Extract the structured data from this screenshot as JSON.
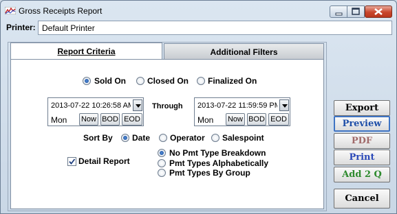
{
  "window": {
    "title": "Gross Receipts Report"
  },
  "printer": {
    "label": "Printer:",
    "value": "Default Printer"
  },
  "tabs": {
    "report_criteria": "Report Criteria",
    "additional_filters": "Additional Filters"
  },
  "date_mode": {
    "options": [
      "Sold On",
      "Closed On",
      "Finalized On"
    ],
    "selected": "Sold On"
  },
  "range": {
    "start": {
      "value": "2013-07-22 10:26:58 AM",
      "day": "Mon"
    },
    "through_label": "Through",
    "end": {
      "value": "2013-07-22 11:59:59 PM",
      "day": "Mon"
    },
    "buttons": {
      "now": "Now",
      "bod": "BOD",
      "eod": "EOD"
    }
  },
  "sort": {
    "label": "Sort By",
    "options": [
      "Date",
      "Operator",
      "Salespoint"
    ],
    "selected": "Date"
  },
  "detail_report": {
    "label": "Detail Report",
    "checked": true
  },
  "pmt": {
    "options": [
      "No Pmt Type Breakdown",
      "Pmt Types Alphabetically",
      "Pmt Types By Group"
    ],
    "selected": "No Pmt Type Breakdown"
  },
  "side_buttons": {
    "export": "Export",
    "preview": "Preview",
    "pdf": "PDF",
    "print": "Print",
    "add2q": "Add 2 Q",
    "cancel": "Cancel"
  },
  "colors": {
    "preview_border": "#3f74c4",
    "pdf_text": "#a06a6a",
    "print_text": "#2a48b8",
    "add2q_text": "#2d8a2d",
    "close_button": "#c9462c"
  },
  "icons": [
    "app-icon",
    "minimize-icon",
    "maximize-icon",
    "close-icon",
    "dropdown-arrow-icon",
    "checkmark-icon"
  ]
}
